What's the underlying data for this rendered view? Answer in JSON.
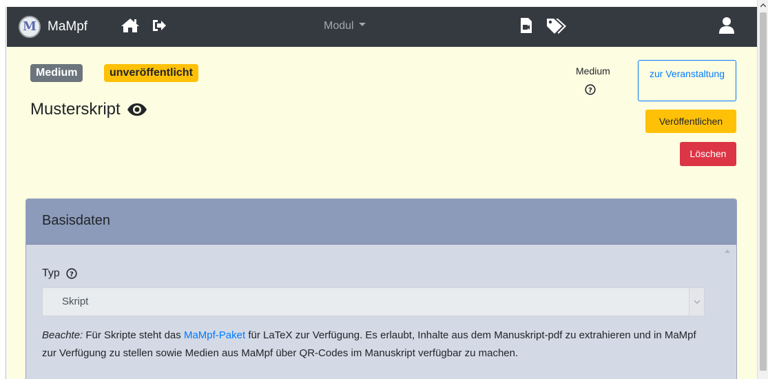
{
  "navbar": {
    "brand": "MaMpf",
    "dropdown": "Modul"
  },
  "header": {
    "badge_type": "Medium",
    "badge_status": "unveröffentlicht",
    "title": "Musterskript",
    "medium_label": "Medium"
  },
  "actions": {
    "to_event_label": "zur Veranstaltung",
    "publish_label": "Veröffentlichen",
    "delete_label": "Löschen"
  },
  "card": {
    "title": "Basisdaten",
    "type_label": "Typ",
    "type_value": "Skript",
    "note_prefix": "Beachte:",
    "note_part1": " Für Skripte steht das ",
    "note_link": "MaMpf-Paket",
    "note_part2": " für LaTeX zur Verfügung. Es erlaubt, Inhalte aus dem Manuskript-pdf zu extrahieren und in MaMpf zur Verfügung zu stellen sowie Medien aus MaMpf über QR-Codes im Manuskript verfügbar zu machen."
  },
  "colors": {
    "navbar": "#343a40",
    "page_background": "#fdfde1",
    "card_header": "#8c9bba",
    "card_body": "#d3d9e5",
    "primary": "#007bff",
    "warning": "#ffc107",
    "danger": "#dc3545",
    "secondary": "#6c757d"
  },
  "icons": [
    "home-icon",
    "sign-out-icon",
    "file-video-icon",
    "tags-icon",
    "user-icon",
    "eye-icon",
    "question-circle-icon"
  ]
}
